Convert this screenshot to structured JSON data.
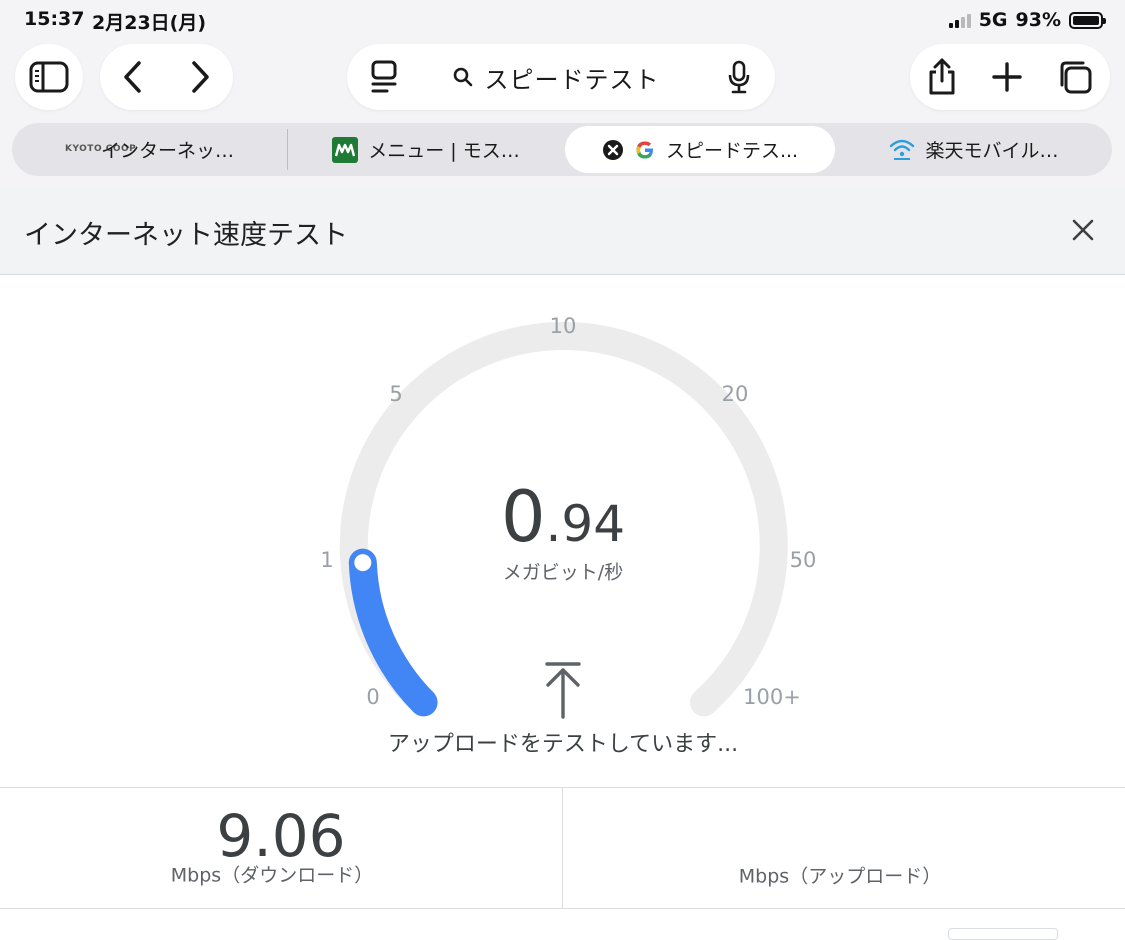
{
  "status_bar": {
    "time": "15:37",
    "date": "2月23日(月)",
    "network": "5G",
    "battery": "93%",
    "battery_level": 0.93
  },
  "toolbar": {
    "sidebar_icon": "sidebar-icon",
    "back_icon": "chevron-left-icon",
    "forward_icon": "chevron-right-icon",
    "reader_icon": "page-menu-icon",
    "address_text": "スピードテスト",
    "search_icon": "search-icon",
    "mic_icon": "microphone-icon",
    "share_icon": "share-icon",
    "new_tab_icon": "plus-icon",
    "tabs_icon": "tabs-overview-icon"
  },
  "tabs": [
    {
      "label": "インターネッ…",
      "favicon": "kyoto-coop-logo",
      "favicon_text": "KYOTO COOP"
    },
    {
      "label": "メニュー | モス…",
      "favicon": "mos-burger-logo"
    },
    {
      "label": "スピードテス...",
      "favicon": "google-logo",
      "active": true,
      "close_icon": "close-circle-icon"
    },
    {
      "label": "楽天モバイル…",
      "favicon": "wifi-rental-logo"
    }
  ],
  "card": {
    "title": "インターネット速度テスト",
    "close_icon": "close-icon"
  },
  "gauge": {
    "ticks": [
      "0",
      "1",
      "5",
      "10",
      "20",
      "50",
      "100+"
    ],
    "value_int": "0",
    "value_dec": ".94",
    "unit": "メガビット/秒",
    "status": "アップロードをテストしています...",
    "arrow_icon": "upload-arrow-icon",
    "accent_color": "#4285f4",
    "track_color": "#ececec"
  },
  "results": {
    "download_value": "9.06",
    "download_label": "Mbps（ダウンロード）",
    "upload_label": "Mbps（アップロード）"
  }
}
